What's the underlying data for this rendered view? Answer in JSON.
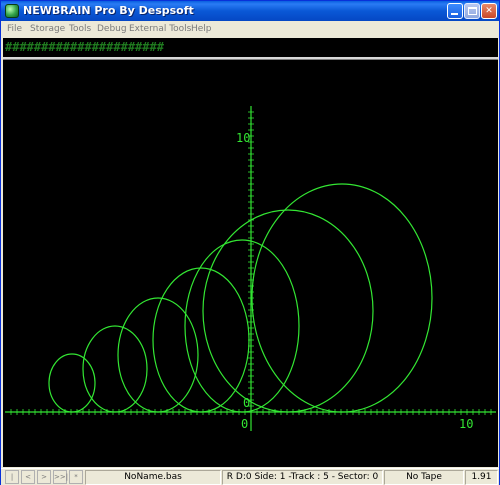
{
  "window": {
    "title": "NEWBRAIN Pro By Despsoft",
    "controls": {
      "minimize": "minimize",
      "maximize": "maximize",
      "close": "✕"
    }
  },
  "menu": [
    "File",
    "Storage",
    "Tools",
    "Debug",
    "External Tools",
    "Help"
  ],
  "screen": {
    "hash_row": "######################",
    "plot_color": "#33e633",
    "y_axis_label_top": "10",
    "y_axis_label_zero": "0",
    "x_axis_label_zero": "0",
    "x_axis_label_right": "10"
  },
  "statusbar": {
    "nav_buttons": [
      "|<<",
      "<",
      ">",
      ">>|",
      "*"
    ],
    "filename": "NoName.bas",
    "disk_status": "R D:0 Side: 1 -Track : 5 - Sector: 0",
    "tape_status": "No Tape",
    "version": "1.91"
  }
}
